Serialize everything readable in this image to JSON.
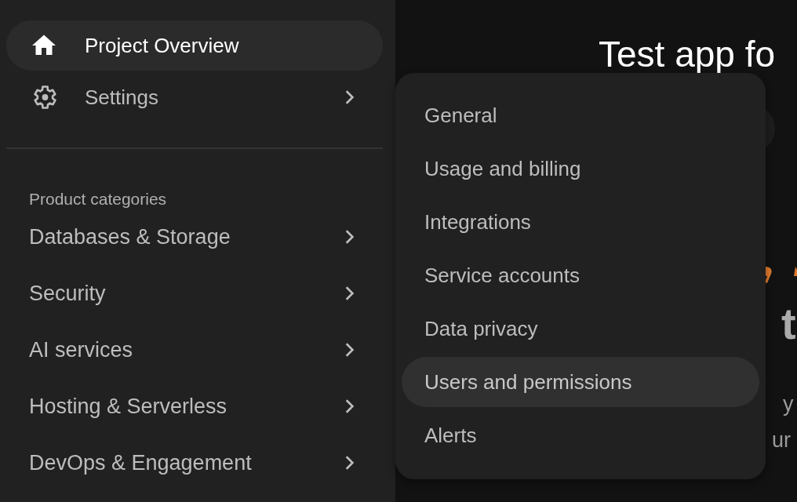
{
  "sidebar": {
    "nav": [
      {
        "label": "Project Overview",
        "selected": true
      },
      {
        "label": "Settings",
        "selected": false
      }
    ],
    "section_title": "Product categories",
    "categories": [
      {
        "label": "Databases & Storage"
      },
      {
        "label": "Security"
      },
      {
        "label": "AI services"
      },
      {
        "label": "Hosting & Serverless"
      },
      {
        "label": "DevOps & Engagement"
      }
    ]
  },
  "main": {
    "title": "Test app fo",
    "heading_fragment": "t",
    "text_fragments": [
      "y",
      "ur"
    ]
  },
  "settings_menu": {
    "items": [
      {
        "label": "General",
        "selected": false
      },
      {
        "label": "Usage and billing",
        "selected": false
      },
      {
        "label": "Integrations",
        "selected": false
      },
      {
        "label": "Service accounts",
        "selected": false
      },
      {
        "label": "Data privacy",
        "selected": false
      },
      {
        "label": "Users and permissions",
        "selected": true
      },
      {
        "label": "Alerts",
        "selected": false
      }
    ]
  }
}
